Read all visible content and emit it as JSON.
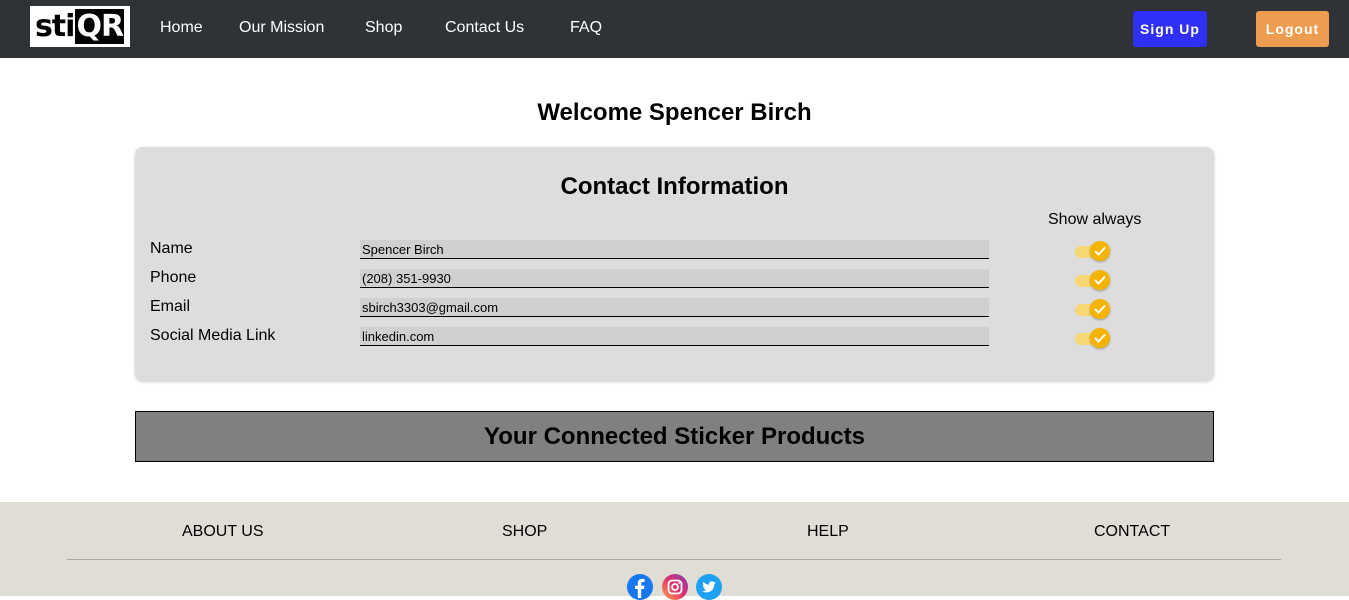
{
  "nav": {
    "logo_text_a": "sti",
    "logo_text_b": "QR",
    "links": [
      "Home",
      "Our Mission",
      "Shop",
      "Contact Us",
      "FAQ"
    ],
    "signup_label": "Sign Up",
    "logout_label": "Logout"
  },
  "welcome": "Welcome Spencer Birch",
  "contact": {
    "title": "Contact Information",
    "show_always_label": "Show always",
    "rows": [
      {
        "label": "Name",
        "value": "Spencer Birch",
        "show_always": true
      },
      {
        "label": "Phone",
        "value": "(208) 351-9930",
        "show_always": true
      },
      {
        "label": "Email",
        "value": "sbirch3303@gmail.com",
        "show_always": true
      },
      {
        "label": "Social Media Link",
        "value": "linkedin.com",
        "show_always": true
      }
    ]
  },
  "products_title": "Your Connected Sticker Products",
  "footer": {
    "links": [
      "ABOUT US",
      "SHOP",
      "HELP",
      "CONTACT"
    ],
    "social_icons": [
      "facebook-icon",
      "instagram-icon",
      "twitter-icon"
    ]
  },
  "colors": {
    "navbar": "#2f3337",
    "signup": "#2f2ff5",
    "logout": "#ee9c4f",
    "toggle_on": "#f5b400",
    "footer": "#dfddd4"
  }
}
